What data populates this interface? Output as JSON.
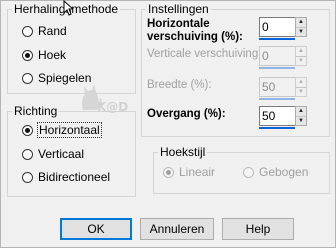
{
  "repeat_group": {
    "title": "Herhalingsmethode",
    "options": [
      {
        "label": "Rand",
        "checked": false
      },
      {
        "label": "Hoek",
        "checked": true
      },
      {
        "label": "Spiegelen",
        "checked": false
      }
    ]
  },
  "direction_group": {
    "title": "Richting",
    "options": [
      {
        "label": "Horizontaal",
        "checked": true
      },
      {
        "label": "Verticaal",
        "checked": false
      },
      {
        "label": "Bidirectioneel",
        "checked": false
      }
    ]
  },
  "settings_group": {
    "title": "Instellingen",
    "horizontal": {
      "label_line1": "Horizontale",
      "label_line2": "verschuiving (%):",
      "value": "0"
    },
    "vertical": {
      "label": "Verticale verschuiving (%):",
      "value": "0"
    },
    "width": {
      "label": "Breedte (%):",
      "value": "50"
    },
    "transition": {
      "label": "Overgang (%):",
      "value": "50"
    }
  },
  "corner_group": {
    "title": "Hoekstijl",
    "options": [
      {
        "label": "Lineair",
        "checked": true
      },
      {
        "label": "Gebogen",
        "checked": false
      }
    ]
  },
  "buttons": {
    "ok": "OK",
    "cancel": "Annuleren",
    "help": "Help"
  },
  "watermark": {
    "text": "K@D"
  },
  "colors": {
    "accent_bar": "#0a64d8",
    "default_button_border": "#0078d7"
  }
}
